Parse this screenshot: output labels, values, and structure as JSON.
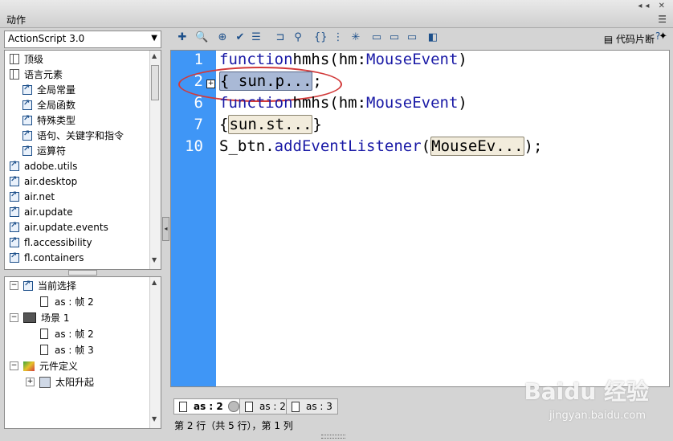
{
  "panel": {
    "title": "动作"
  },
  "left": {
    "combo_value": "ActionScript 3.0",
    "toolbox": [
      {
        "label": "顶级",
        "icon": "book-icon",
        "indent": 0
      },
      {
        "label": "语言元素",
        "icon": "open-book-icon",
        "indent": 0
      },
      {
        "label": "全局常量",
        "icon": "element-icon",
        "indent": 1
      },
      {
        "label": "全局函数",
        "icon": "element-icon",
        "indent": 1
      },
      {
        "label": "特殊类型",
        "icon": "element-icon",
        "indent": 1
      },
      {
        "label": "语句、关键字和指令",
        "icon": "element-icon",
        "indent": 1
      },
      {
        "label": "运算符",
        "icon": "element-icon",
        "indent": 1
      },
      {
        "label": "adobe.utils",
        "icon": "package-icon",
        "indent": 0
      },
      {
        "label": "air.desktop",
        "icon": "package-icon",
        "indent": 0
      },
      {
        "label": "air.net",
        "icon": "package-icon",
        "indent": 0
      },
      {
        "label": "air.update",
        "icon": "package-icon",
        "indent": 0
      },
      {
        "label": "air.update.events",
        "icon": "package-icon",
        "indent": 0
      },
      {
        "label": "fl.accessibility",
        "icon": "package-icon",
        "indent": 0
      },
      {
        "label": "fl.containers",
        "icon": "package-icon",
        "indent": 0
      }
    ],
    "script_nav": [
      {
        "label": "当前选择",
        "type": "folder",
        "exp": "−"
      },
      {
        "label": "as : 帧 2",
        "type": "doc"
      },
      {
        "label": "场景 1",
        "type": "scene",
        "exp": "−"
      },
      {
        "label": "as : 帧 2",
        "type": "doc"
      },
      {
        "label": "as : 帧 3",
        "type": "doc"
      },
      {
        "label": "元件定义",
        "type": "sym",
        "exp": "−"
      },
      {
        "label": "太阳升起",
        "type": "gfx",
        "exp": "+"
      }
    ]
  },
  "toolbar": {
    "snippets_label": "代码片断"
  },
  "editor": {
    "lines": [
      {
        "num": "1",
        "parts": [
          [
            "kw",
            "function"
          ],
          [
            "",
            "hmhs(hm:"
          ],
          [
            "ty",
            "MouseEvent"
          ],
          [
            "",
            ")"
          ]
        ]
      },
      {
        "num": "2",
        "fold_selected": "{ sun.p...",
        "after": ";"
      },
      {
        "num": "6",
        "parts": [
          [
            "kw",
            "function"
          ],
          [
            "",
            "hmhs(hm:"
          ],
          [
            "ty",
            "MouseEvent"
          ],
          [
            "",
            ")"
          ]
        ]
      },
      {
        "num": "7",
        "brace": "{",
        "fold": "sun.st...",
        "after": "}"
      },
      {
        "num": "10",
        "pre": "S_btn.",
        "method": "addEventListener",
        "open": "(",
        "fold": "MouseEv...",
        "close": ");"
      }
    ]
  },
  "tabs": [
    {
      "label": "as : 2",
      "active": true
    },
    {
      "label": "as : 2",
      "active": false
    },
    {
      "label": "as : 3",
      "active": false
    }
  ],
  "status": "第 2 行（共 5 行），第 1 列",
  "watermark": {
    "brand": "Baidu 经验",
    "url": "jingyan.baidu.com"
  }
}
